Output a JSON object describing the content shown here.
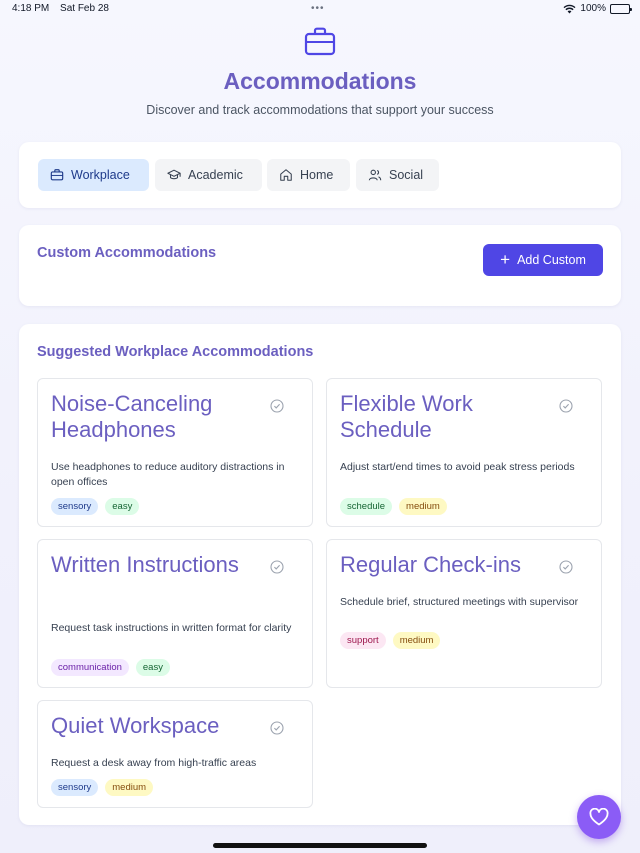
{
  "status_bar": {
    "time": "4:18 PM",
    "date": "Sat Feb 28",
    "battery": "100%",
    "dots": "•••"
  },
  "header": {
    "icon": "briefcase-icon",
    "title": "Accommodations",
    "subtitle": "Discover and track accommodations that support your success"
  },
  "tabs": [
    {
      "label": "Workplace",
      "icon": "briefcase-icon",
      "active": true
    },
    {
      "label": "Academic",
      "icon": "graduation-cap-icon",
      "active": false
    },
    {
      "label": "Home",
      "icon": "home-icon",
      "active": false
    },
    {
      "label": "Social",
      "icon": "users-icon",
      "active": false
    }
  ],
  "custom": {
    "title": "Custom Accommodations",
    "add_label": "Add Custom"
  },
  "suggested": {
    "title": "Suggested Workplace Accommodations",
    "items": [
      {
        "title": "Noise-Canceling Headphones",
        "description": "Use headphones to reduce auditory distractions in open offices",
        "tags": [
          "sensory",
          "easy"
        ]
      },
      {
        "title": "Flexible Work Schedule",
        "description": "Adjust start/end times to avoid peak stress periods",
        "tags": [
          "schedule",
          "medium"
        ]
      },
      {
        "title": "Written Instructions",
        "description": "Request task instructions in written format for clarity",
        "tags": [
          "communication",
          "easy"
        ]
      },
      {
        "title": "Regular Check-ins",
        "description": "Schedule brief, structured meetings with supervisor",
        "tags": [
          "support",
          "medium"
        ]
      },
      {
        "title": "Quiet Workspace",
        "description": "Request a desk away from high-traffic areas",
        "tags": [
          "sensory",
          "medium"
        ]
      }
    ]
  },
  "colors": {
    "accent": "#6b5fc0",
    "button": "#4f46e5",
    "fab": "#8b5cf6",
    "active_tab": "#dbeafe"
  },
  "fab": {
    "icon": "heart-icon"
  }
}
